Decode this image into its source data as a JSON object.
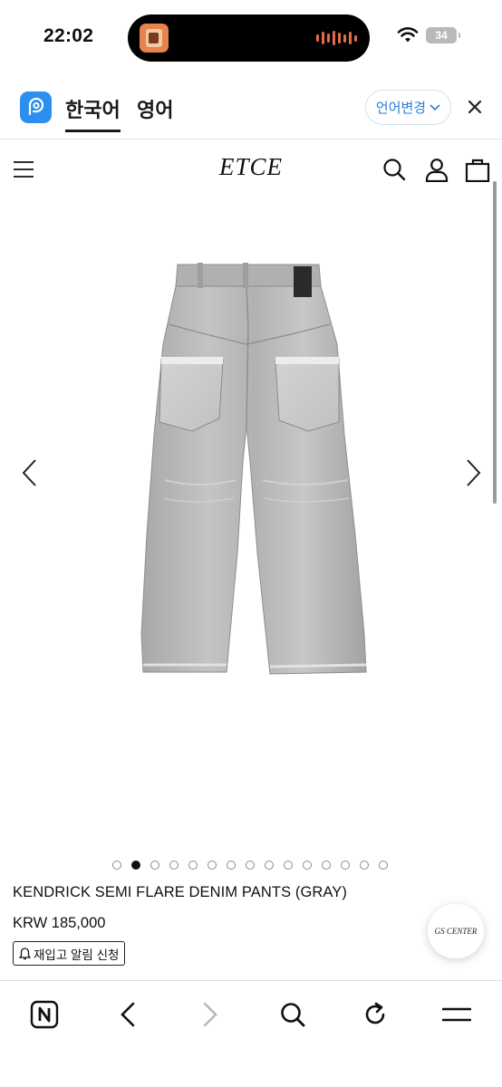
{
  "status_bar": {
    "time": "22:02",
    "battery": "34",
    "wifi_icon": "wifi-icon",
    "island_wave_color": "#e46c49"
  },
  "language_bar": {
    "tabs": [
      {
        "label": "한국어",
        "active": true
      },
      {
        "label": "영어",
        "active": false
      }
    ],
    "change_button": "언어변경",
    "logo_color": "#2c8ef0",
    "accent_color": "#2a7fd4"
  },
  "shop_header": {
    "brand": "ETCE",
    "icons": [
      "menu-icon",
      "search-icon",
      "account-icon",
      "bag-icon"
    ]
  },
  "product": {
    "image_description_icon": "product-photo-gray-denim-pants",
    "carousel": {
      "total": 15,
      "active_index": 1
    },
    "name": "KENDRICK SEMI FLARE DENIM PANTS (GRAY)",
    "price": "KRW 185,000",
    "restock_label": "재입고 알림 신청"
  },
  "cs_button": {
    "label": "GS CENTER"
  },
  "bottom_toolbar": {
    "items": [
      "naver-home-icon",
      "back-icon",
      "forward-icon",
      "search-icon",
      "reload-icon",
      "menu-icon"
    ]
  }
}
